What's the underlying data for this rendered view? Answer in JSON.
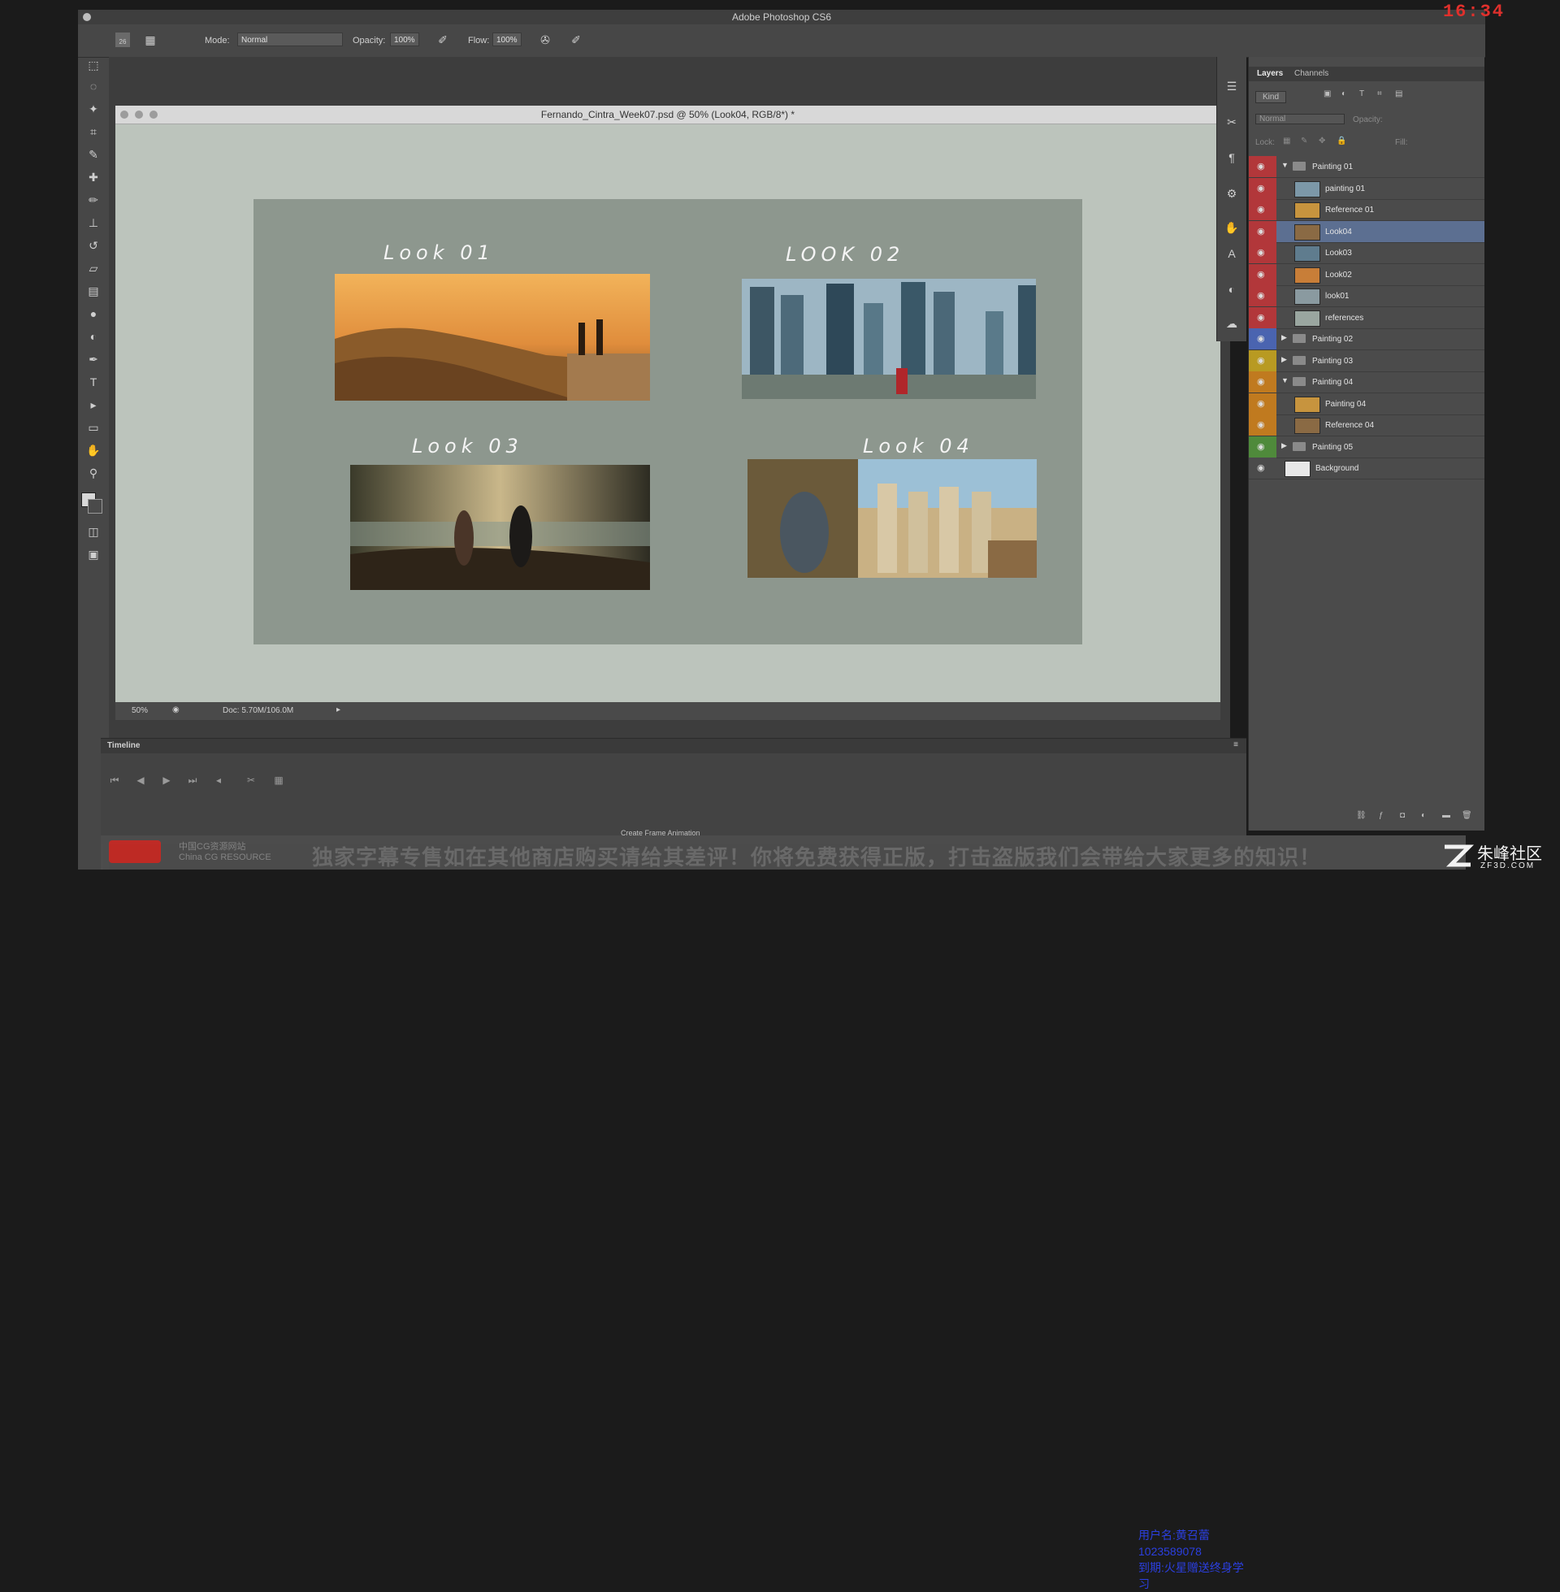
{
  "app_title": "Adobe Photoshop CS6",
  "recording_time": "16:34",
  "options_bar": {
    "brush_size": "26",
    "mode_label": "Mode:",
    "mode_value": "Normal",
    "opacity_label": "Opacity:",
    "opacity_value": "100%",
    "flow_label": "Flow:",
    "flow_value": "100%"
  },
  "document": {
    "tab_title": "Fernando_Cintra_Week07.psd @ 50% (Look04, RGB/8*) *",
    "zoom": "50%",
    "doc_size": "Doc: 5.70M/106.0M",
    "looks": [
      {
        "label": "Look 01"
      },
      {
        "label": "LOOK 02"
      },
      {
        "label": "Look 03"
      },
      {
        "label": "Look 04"
      }
    ]
  },
  "layers_panel": {
    "tabs": [
      "Layers",
      "Channels"
    ],
    "filter_kind": "Kind",
    "blend_mode": "Normal",
    "opacity_label": "Opacity:",
    "lock_label": "Lock:",
    "fill_label": "Fill:",
    "layers": [
      {
        "name": "Painting 01",
        "type": "group",
        "expanded": true,
        "color": "#b2373a"
      },
      {
        "name": "painting 01",
        "type": "layer",
        "color": "#b2373a"
      },
      {
        "name": "Reference 01",
        "type": "layer",
        "color": "#b2373a"
      },
      {
        "name": "Look04",
        "type": "layer",
        "color": "#b2373a",
        "selected": true
      },
      {
        "name": "Look03",
        "type": "layer",
        "color": "#b2373a"
      },
      {
        "name": "Look02",
        "type": "layer",
        "color": "#b2373a"
      },
      {
        "name": "look01",
        "type": "layer",
        "color": "#b2373a"
      },
      {
        "name": "references",
        "type": "layer",
        "color": "#b2373a"
      },
      {
        "name": "Painting 02",
        "type": "group",
        "expanded": false,
        "color": "#4a64b0"
      },
      {
        "name": "Painting 03",
        "type": "group",
        "expanded": false,
        "color": "#b89a22"
      },
      {
        "name": "Painting 04",
        "type": "group",
        "expanded": true,
        "color": "#c07a1f"
      },
      {
        "name": "Painting 04",
        "type": "layer",
        "color": "#c07a1f"
      },
      {
        "name": "Reference 04",
        "type": "layer",
        "color": "#c07a1f"
      },
      {
        "name": "Painting 05",
        "type": "group",
        "expanded": false,
        "color": "#4f8a3b"
      },
      {
        "name": "Background",
        "type": "layer",
        "color": "#4b4b4b"
      }
    ]
  },
  "timeline": {
    "title": "Timeline",
    "create_frame_animation": "Create Frame Animation"
  },
  "overlay": {
    "blue_line1": "用户名:黄召蕾1023589078",
    "blue_line2": "到期:火星赠送终身学习",
    "banner_text": "独家字幕专售如在其他商店购买请给其差评！你将免费获得正版，打击盗版我们会带给大家更多的知识！",
    "banner_logo_line1": "中国CG资源网站",
    "banner_logo_line2": "China CG RESOURCE",
    "site_name": "朱峰社区",
    "site_url": "ZF3D.COM"
  }
}
